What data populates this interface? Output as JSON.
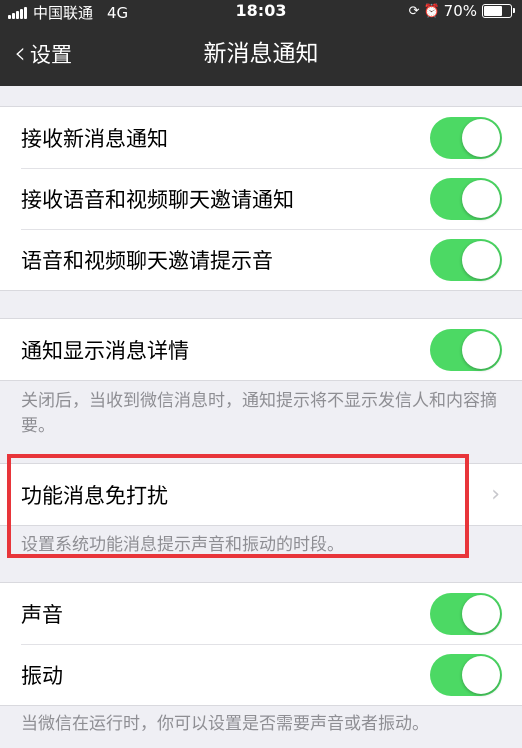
{
  "status": {
    "carrier": "中国联通",
    "network": "4G",
    "time": "18:03",
    "battery": "70%",
    "battery_level": 0.7,
    "icons": [
      "lock-rotation-icon",
      "alarm-icon"
    ]
  },
  "nav": {
    "back_label": "设置",
    "title": "新消息通知"
  },
  "group1": [
    {
      "label": "接收新消息通知",
      "on": true
    },
    {
      "label": "接收语音和视频聊天邀请通知",
      "on": true
    },
    {
      "label": "语音和视频聊天邀请提示音",
      "on": true
    }
  ],
  "group2": {
    "label": "通知显示消息详情",
    "on": true,
    "note": "关闭后，当收到微信消息时，通知提示将不显示发信人和内容摘要。"
  },
  "group3": {
    "label": "功能消息免打扰",
    "note": "设置系统功能消息提示声音和振动的时段。"
  },
  "group4": [
    {
      "label": "声音",
      "on": true
    },
    {
      "label": "振动",
      "on": true
    }
  ],
  "footer_note": "当微信在运行时，你可以设置是否需要声音或者振动。",
  "colors": {
    "toggle_on": "#4cd964",
    "navbar": "#2e2e2e",
    "background": "#efeff4",
    "highlight": "#e8353a"
  }
}
